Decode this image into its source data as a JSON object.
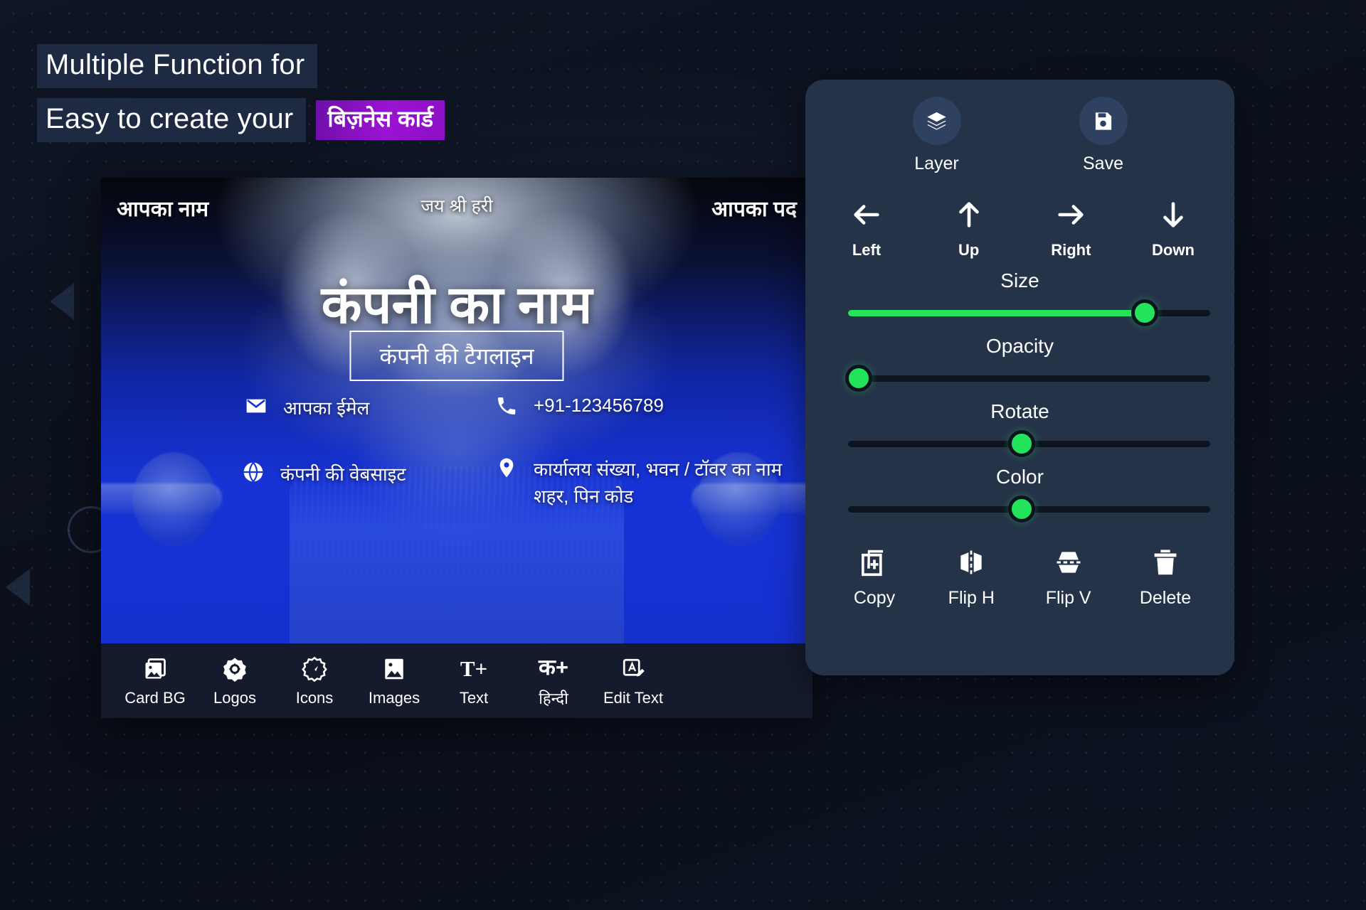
{
  "headline": {
    "line1": "Multiple Function for",
    "line2": "Easy to create your",
    "badge": "बिज़नेस कार्ड",
    "badge_color": "#9b13d4",
    "chip_bg": "#1e2a42"
  },
  "card": {
    "name": "आपका नाम",
    "slogan": "जय श्री हरी",
    "designation": "आपका पद",
    "company": "कंपनी का नाम",
    "tagline": "कंपनी की टैगलाइन",
    "email": "आपका ईमेल",
    "phone": "+91-123456789",
    "website": "कंपनी की वेबसाइट",
    "address_line1": "कार्यालय संख्या, भवन / टॉवर का नाम",
    "address_line2": "शहर, पिन कोड",
    "toolbar": [
      {
        "label": "Card BG",
        "icon": "image-stack-icon"
      },
      {
        "label": "Logos",
        "icon": "logo-badge-icon"
      },
      {
        "label": "Icons",
        "icon": "star-burst-icon"
      },
      {
        "label": "Images",
        "icon": "picture-icon"
      },
      {
        "label": "Text",
        "icon": "text-add-icon",
        "glyph": "T+"
      },
      {
        "label": "हिन्दी",
        "icon": "hindi-add-icon",
        "glyph": "क+"
      },
      {
        "label": "Edit Text",
        "icon": "edit-text-icon"
      }
    ]
  },
  "panel": {
    "top_buttons": [
      {
        "label": "Layer",
        "icon": "layers-icon"
      },
      {
        "label": "Save",
        "icon": "floppy-save-icon"
      }
    ],
    "arrows": [
      {
        "label": "Left",
        "icon": "arrow-left-icon"
      },
      {
        "label": "Up",
        "icon": "arrow-up-icon"
      },
      {
        "label": "Right",
        "icon": "arrow-right-icon"
      },
      {
        "label": "Down",
        "icon": "arrow-down-icon"
      }
    ],
    "sliders": [
      {
        "label": "Size",
        "value": 82,
        "filled": true,
        "accent": "#22e45a"
      },
      {
        "label": "Opacity",
        "value": 3,
        "filled": false,
        "accent": "#22e45a"
      },
      {
        "label": "Rotate",
        "value": 48,
        "filled": false,
        "accent": "#22e45a"
      },
      {
        "label": "Color",
        "value": 48,
        "filled": false,
        "accent": "#22e45a"
      }
    ],
    "actions": [
      {
        "label": "Copy",
        "icon": "copy-icon"
      },
      {
        "label": "Flip H",
        "icon": "flip-horizontal-icon"
      },
      {
        "label": "Flip V",
        "icon": "flip-vertical-icon"
      },
      {
        "label": "Delete",
        "icon": "trash-icon"
      }
    ]
  }
}
